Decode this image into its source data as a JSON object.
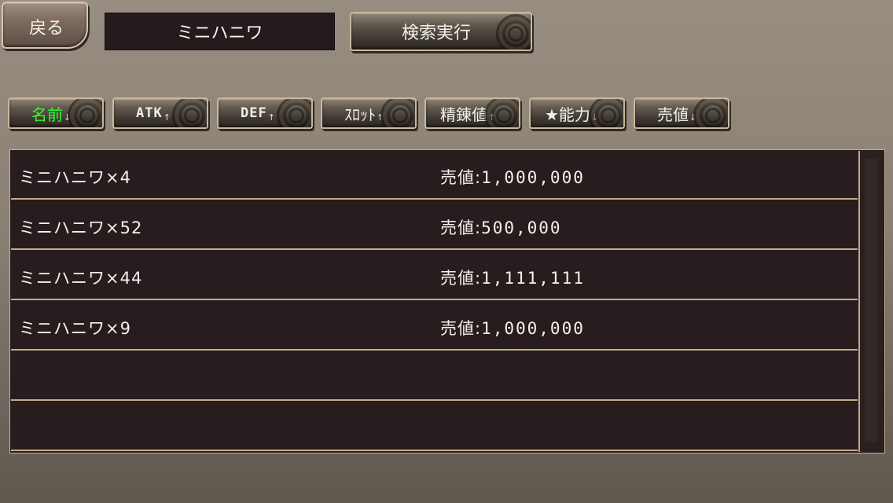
{
  "header": {
    "back_label": "戻る",
    "search_value": "ミニハニワ",
    "search_button_label": "検索実行"
  },
  "sort_buttons": [
    {
      "label": "名前",
      "arrow": "↓",
      "active": true
    },
    {
      "label": "ATK",
      "arrow": "↑",
      "active": false
    },
    {
      "label": "DEF",
      "arrow": "↑",
      "active": false
    },
    {
      "label": "ｽﾛｯﾄ",
      "arrow": "↑",
      "active": false
    },
    {
      "label": "精錬値",
      "arrow": "↑",
      "active": false
    },
    {
      "label": "★能力",
      "arrow": "↓",
      "active": false
    },
    {
      "label": "売値",
      "arrow": "↓",
      "active": false
    }
  ],
  "list": {
    "price_prefix": "売値:",
    "items": [
      {
        "name": "ミニハニワ×4",
        "price": "1,000,000"
      },
      {
        "name": "ミニハニワ×52",
        "price": "500,000"
      },
      {
        "name": "ミニハニワ×44",
        "price": "1,111,111"
      },
      {
        "name": "ミニハニワ×9",
        "price": "1,000,000"
      },
      {
        "name": "",
        "price": ""
      },
      {
        "name": "",
        "price": ""
      }
    ]
  },
  "colors": {
    "active_sort_text": "#2cff2c",
    "list_background": "#271d1f",
    "row_divider": "#c3ad88"
  }
}
